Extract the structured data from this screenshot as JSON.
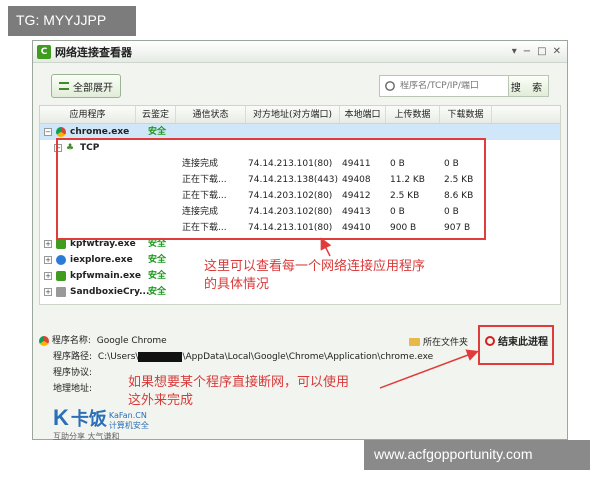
{
  "watermark_top": "TG: MYYJJPP",
  "watermark_bottom": "www.acfgopportunity.com",
  "window": {
    "title": "网络连接查看器",
    "icon_letter": "C"
  },
  "toolbar": {
    "expand_label": "全部展开",
    "search_placeholder": "程序名/TCP/IP/端口",
    "search_button": "搜 索"
  },
  "columns": [
    "应用程序",
    "云鉴定",
    "通信状态",
    "对方地址(对方端口)",
    "本地端口",
    "上传数据",
    "下载数据"
  ],
  "processes": [
    {
      "name": "chrome.exe",
      "verdict": "安全",
      "expanded": true,
      "icon": "chrome-icon"
    },
    {
      "name": "kpfwtray.exe",
      "verdict": "安全",
      "icon": "kingsoft-icon"
    },
    {
      "name": "iexplore.exe",
      "verdict": "安全",
      "icon": "ie-icon"
    },
    {
      "name": "kpfwmain.exe",
      "verdict": "安全",
      "icon": "kingsoft-icon"
    },
    {
      "name": "SandboxieCry...",
      "verdict": "安全",
      "icon": "sandbox-icon"
    }
  ],
  "tcp_label": "TCP",
  "connections": [
    {
      "status": "连接完成",
      "remote": "74.14.213.101(80)",
      "local": "49411",
      "up": "0 B",
      "down": "0 B"
    },
    {
      "status": "正在下载...",
      "remote": "74.14.213.138(443)",
      "local": "49408",
      "up": "11.2 KB",
      "down": "2.5 KB"
    },
    {
      "status": "正在下载...",
      "remote": "74.14.203.102(80)",
      "local": "49412",
      "up": "2.5 KB",
      "down": "8.6 KB"
    },
    {
      "status": "连接完成",
      "remote": "74.14.203.102(80)",
      "local": "49413",
      "up": "0 B",
      "down": "0 B"
    },
    {
      "status": "正在下载...",
      "remote": "74.14.213.101(80)",
      "local": "49410",
      "up": "900 B",
      "down": "907 B"
    }
  ],
  "annotations": {
    "a1_line1": "这里可以查看每一个网络连接应用程序",
    "a1_line2": "的具体情况",
    "a2_line1": "如果想要某个程序直接断网，可以使用",
    "a2_line2": "这外来完成"
  },
  "details": {
    "name_label": "程序名称:",
    "name_value": "Google Chrome",
    "path_label": "程序路径:",
    "path_prefix": "C:\\Users\\",
    "path_suffix": "\\AppData\\Local\\Google\\Chrome\\Application\\chrome.exe",
    "protocol_label": "程序协议:",
    "address_label": "地理地址:",
    "folder_label": "所在文件夹",
    "end_label": "结束此进程"
  },
  "logo": {
    "mark": "K",
    "name": "卡饭",
    "site": "KaFan.CN",
    "tagline": "计算机安全",
    "motto": "互助分享  大气谦和"
  },
  "colors": {
    "safe": "#1f9a1f",
    "annotation": "#e03c3c",
    "selection": "#cfe7f8"
  }
}
